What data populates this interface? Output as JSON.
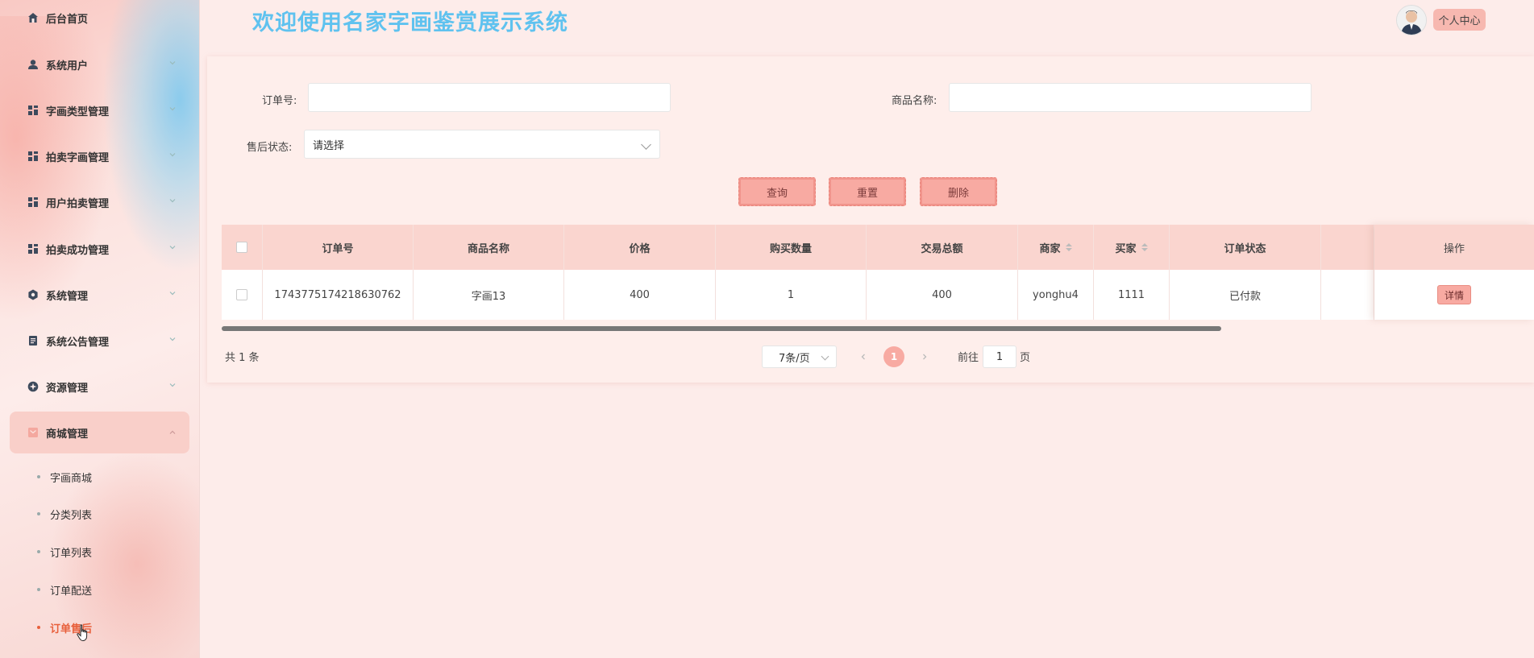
{
  "header": {
    "title": "欢迎使用名家字画鉴赏展示系统",
    "user_center": "个人中心"
  },
  "sidebar": {
    "items": [
      {
        "label": "后台首页",
        "icon": "home-icon"
      },
      {
        "label": "系统用户",
        "icon": "user-icon"
      },
      {
        "label": "字画类型管理",
        "icon": "grid-icon"
      },
      {
        "label": "拍卖字画管理",
        "icon": "grid-icon"
      },
      {
        "label": "用户拍卖管理",
        "icon": "grid-icon"
      },
      {
        "label": "拍卖成功管理",
        "icon": "grid-icon"
      },
      {
        "label": "系统管理",
        "icon": "gear-icon"
      },
      {
        "label": "系统公告管理",
        "icon": "document-icon"
      },
      {
        "label": "资源管理",
        "icon": "compass-icon"
      },
      {
        "label": "商城管理",
        "icon": "shop-icon"
      }
    ],
    "sub_items": [
      {
        "label": "字画商城"
      },
      {
        "label": "分类列表"
      },
      {
        "label": "订单列表"
      },
      {
        "label": "订单配送"
      },
      {
        "label": "订单售后"
      }
    ]
  },
  "search": {
    "order_no_label": "订单号:",
    "order_no_value": "",
    "product_name_label": "商品名称:",
    "product_name_value": "",
    "after_sale_label": "售后状态:",
    "after_sale_placeholder": "请选择"
  },
  "buttons": {
    "query": "查询",
    "reset": "重置",
    "delete": "删除"
  },
  "table": {
    "columns": [
      "订单号",
      "商品名称",
      "价格",
      "购买数量",
      "交易总额",
      "商家",
      "买家",
      "订单状态",
      "",
      "操作"
    ],
    "rows": [
      {
        "order_no": "1743775174218630762",
        "product_name": "字画13",
        "price": "400",
        "quantity": "1",
        "total": "400",
        "seller": "yonghu4",
        "buyer": "1111",
        "status": "已付款",
        "action": "详情"
      }
    ]
  },
  "pagination": {
    "total": "共 1 条",
    "page_size": "7条/页",
    "current_page": "1",
    "goto_label": "前往",
    "goto_value": "1",
    "page_suffix": "页"
  }
}
